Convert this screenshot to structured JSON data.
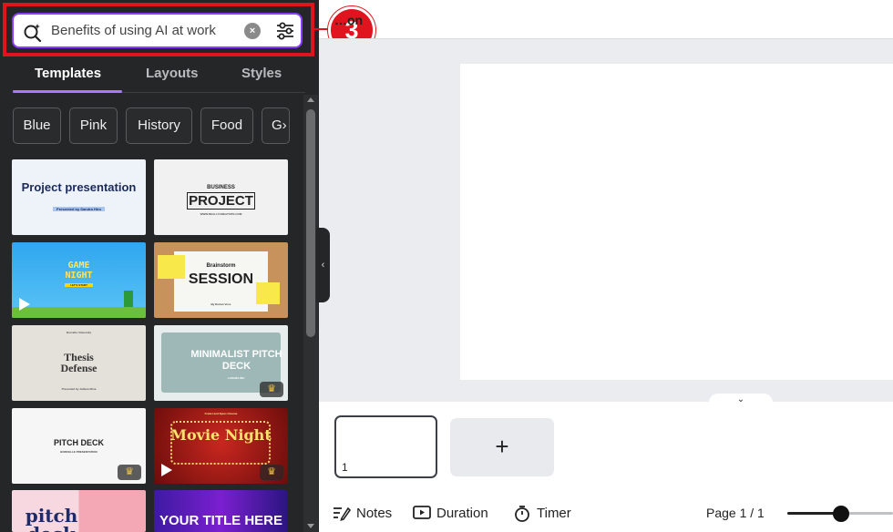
{
  "search": {
    "query": "Benefits of using AI at work",
    "clear_glyph": "×",
    "magic_icon": "magic-search-icon",
    "filter_icon": "filter-sliders-icon"
  },
  "callout": {
    "number": "3"
  },
  "tabs": [
    {
      "label": "Templates",
      "active": true
    },
    {
      "label": "Layouts",
      "active": false
    },
    {
      "label": "Styles",
      "active": false
    }
  ],
  "chips": [
    "Blue",
    "Pink",
    "History",
    "Food",
    "G›"
  ],
  "templates": [
    {
      "title": "Project presentation",
      "subtitle": "Presented by Sandra Hiro"
    },
    {
      "title": "BUSINESS",
      "title2": "PROJECT",
      "subtitle": "WWW.REALLYGREATSITE.COM"
    },
    {
      "title": "GAME NIGHT",
      "subtitle": "LET'S START"
    },
    {
      "title": "Brainstorm",
      "title2": "SESSION",
      "subtitle": "By Dorian Voss"
    },
    {
      "title": "Thesis Defense",
      "subtitle": "Presented by Juliana Silva",
      "header": "Borcelle University"
    },
    {
      "title": "MINIMALIST PITCH DECK",
      "subtitle": "LARANA INC."
    },
    {
      "title": "PITCH DECK",
      "subtitle": "BORCELLE PRESENTATION"
    },
    {
      "title": "Movie Night",
      "subtitle": "Fradel and Spies Cinema"
    },
    {
      "title": "pitch deck"
    },
    {
      "title": "YOUR TITLE HERE"
    }
  ],
  "editor": {
    "title": "…on"
  },
  "pages": {
    "thumb_number": "1",
    "add_symbol": "+"
  },
  "bottom_bar": {
    "notes": "Notes",
    "duration": "Duration",
    "timer": "Timer",
    "page_indicator": "Page 1 / 1"
  },
  "colors": {
    "accent": "#8b3dff",
    "highlight": "#e0141e",
    "panel_bg": "#252627"
  }
}
